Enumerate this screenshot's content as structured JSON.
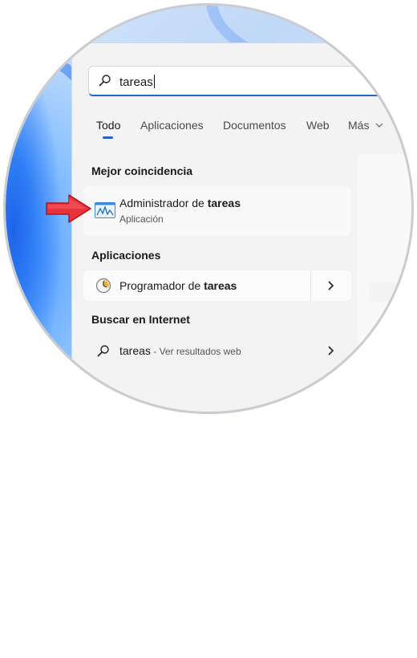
{
  "search": {
    "query": "tareas"
  },
  "tabs": [
    {
      "label": "Todo"
    },
    {
      "label": "Aplicaciones"
    },
    {
      "label": "Documentos"
    },
    {
      "label": "Web"
    },
    {
      "label": "Más"
    }
  ],
  "best_match": {
    "section_title": "Mejor coincidencia",
    "name_prefix": "Administrador de ",
    "name_bold": "tareas",
    "type": "Aplicación"
  },
  "apps": {
    "section_title": "Aplicaciones",
    "items": [
      {
        "name_prefix": "Programador de ",
        "name_bold": "tareas"
      }
    ]
  },
  "web": {
    "section_title": "Buscar en Internet",
    "query": "tareas",
    "suffix": " - Ver resultados web"
  },
  "colors": {
    "accent": "#2563c7",
    "arrow": "#e8333b"
  },
  "icons": {
    "search": "search-icon",
    "task_manager": "task-manager-icon",
    "task_scheduler": "task-scheduler-icon",
    "chevron": "chevron-right-icon",
    "tab_more": "chevron-down-icon",
    "pointer": "red-arrow-pointer"
  }
}
